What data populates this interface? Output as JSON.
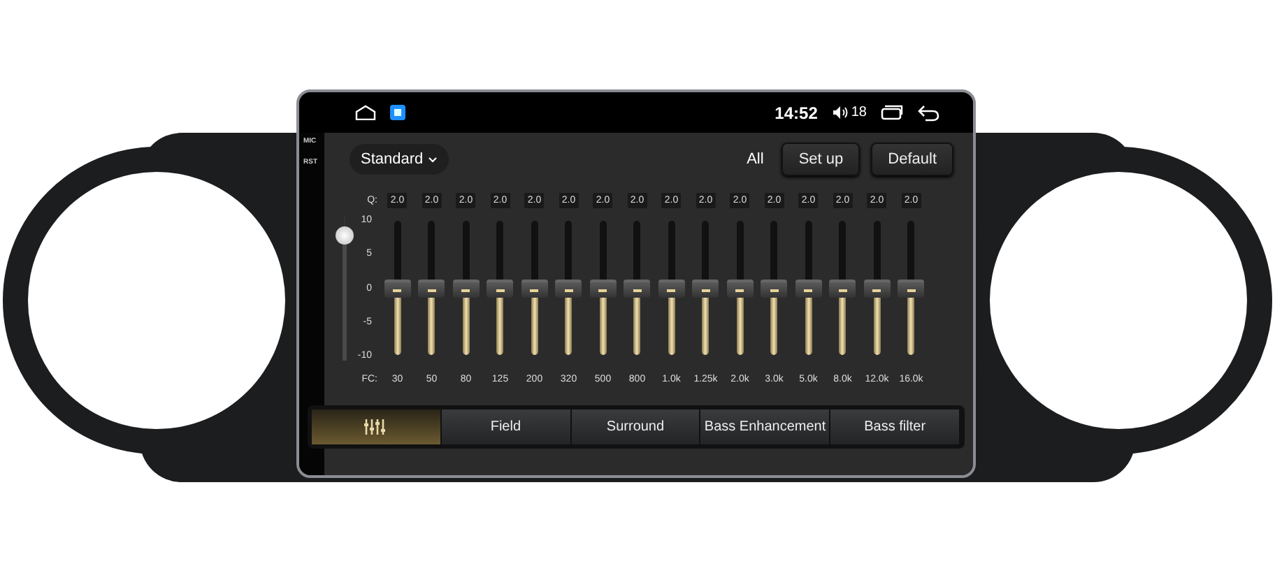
{
  "status_bar": {
    "time": "14:52",
    "volume": "18"
  },
  "bezel_labels": [
    "MIC",
    "RST"
  ],
  "toolbar": {
    "preset": "Standard",
    "all_label": "All",
    "buttons": [
      "Set up",
      "Default"
    ]
  },
  "eq": {
    "q_label": "Q:",
    "fc_label": "FC:",
    "scale": [
      "10",
      "5",
      "0",
      "-5",
      "-10"
    ],
    "master_slider": {
      "level": 0.86
    },
    "bands": [
      {
        "q": "2.0",
        "fc": "30",
        "level": 0.5
      },
      {
        "q": "2.0",
        "fc": "50",
        "level": 0.5
      },
      {
        "q": "2.0",
        "fc": "80",
        "level": 0.5
      },
      {
        "q": "2.0",
        "fc": "125",
        "level": 0.5
      },
      {
        "q": "2.0",
        "fc": "200",
        "level": 0.5
      },
      {
        "q": "2.0",
        "fc": "320",
        "level": 0.5
      },
      {
        "q": "2.0",
        "fc": "500",
        "level": 0.5
      },
      {
        "q": "2.0",
        "fc": "800",
        "level": 0.5
      },
      {
        "q": "2.0",
        "fc": "1.0k",
        "level": 0.5
      },
      {
        "q": "2.0",
        "fc": "1.25k",
        "level": 0.5
      },
      {
        "q": "2.0",
        "fc": "2.0k",
        "level": 0.5
      },
      {
        "q": "2.0",
        "fc": "3.0k",
        "level": 0.5
      },
      {
        "q": "2.0",
        "fc": "5.0k",
        "level": 0.5
      },
      {
        "q": "2.0",
        "fc": "8.0k",
        "level": 0.5
      },
      {
        "q": "2.0",
        "fc": "12.0k",
        "level": 0.5
      },
      {
        "q": "2.0",
        "fc": "16.0k",
        "level": 0.5
      }
    ]
  },
  "tabs": [
    {
      "kind": "icon",
      "selected": true
    },
    {
      "kind": "text",
      "label": "Field",
      "selected": false
    },
    {
      "kind": "text",
      "label": "Surround",
      "selected": false
    },
    {
      "kind": "text",
      "label": "Bass Enhancement",
      "selected": false
    },
    {
      "kind": "text",
      "label": "Bass filter",
      "selected": false
    }
  ]
}
